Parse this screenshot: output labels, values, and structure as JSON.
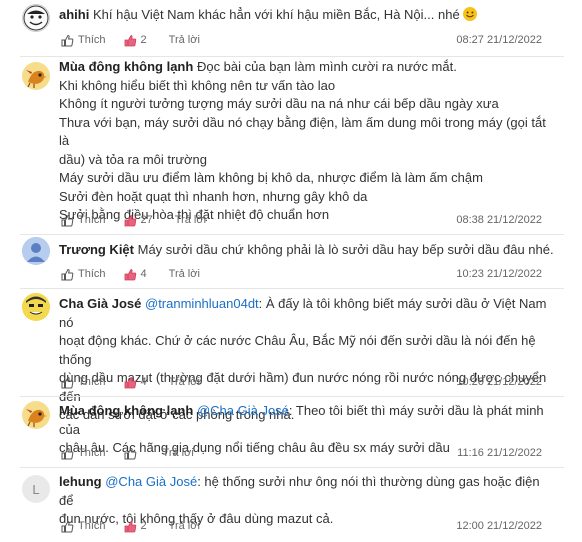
{
  "actions": {
    "like_label": "Thích",
    "reply_label": "Trả lời"
  },
  "colors": {
    "mention": "#1a6fc7",
    "vote_heart": "#d23c5a",
    "author": "#222222",
    "meta": "#666666"
  },
  "comments": [
    {
      "author": "ahihi",
      "avatar_icon": "meme-face-avatar",
      "mention": "",
      "lines": [
        "Khí hậu Việt Nam khác hẳn với khí hậu miền Bắc, Hà Nội... nhé"
      ],
      "has_emoji": true,
      "votes": "2",
      "time": "08:27 21/12/2022"
    },
    {
      "author": "Mùa đông không lạnh",
      "avatar_icon": "bird-avatar",
      "mention": "",
      "lines": [
        "Đọc bài của bạn làm mình cười ra nước mắt.",
        "Khi không hiểu biết thì không nên tư vấn tào lao",
        "Không ít người tưởng tượng máy sưởi dầu na ná như cái bếp dầu ngày xưa",
        "Thưa với bạn, máy sưởi dầu nó chạy bằng điện, làm ấm dung môi trong máy (gọi tắt là",
        "dầu) và tỏa ra môi trường",
        "Máy sưởi dầu ưu điểm làm không bị khô da, nhược điểm là làm ấm chậm",
        "Sưởi đèn hoặt quạt thì nhanh hơn, nhưng gây khô da",
        "Sưởi bằng điều hòa thì đặt nhiệt độ chuẩn hơn"
      ],
      "votes": "27",
      "time": "08:38 21/12/2022"
    },
    {
      "author": "Trương Kiệt",
      "avatar_icon": "default-user-avatar",
      "mention": "",
      "lines": [
        "Máy sưởi dầu chứ không phải là lò sưởi dầu hay bếp sưởi dầu đâu nhé."
      ],
      "votes": "4",
      "time": "10:23 21/12/2022"
    },
    {
      "author": "Cha Già José",
      "avatar_icon": "cartoon-face-avatar",
      "mention": "@tranminhluan04dt",
      "lines": [
        ": À đấy là tôi không biết máy sưởi dầu ở Việt Nam nó",
        "hoạt động khác. Chứ ở các nước Châu Âu, Bắc Mỹ nói đến sưởi dầu là nói đến hệ thống",
        "dùng dầu mazut (thường đặt dưới hầm) đun nước nóng rồi nước nóng được chuyển đến",
        "các dàn sưởi đặt ở các phòng trong nhà."
      ],
      "votes": "4",
      "time": "10:26 21/12/2022"
    },
    {
      "author": "Mùa đông không lạnh",
      "avatar_icon": "bird-avatar",
      "mention": "@Cha Già José",
      "lines": [
        ": Theo tôi biết thì máy sưởi dầu là phát minh của",
        "châu âu. Các hãng gia dụng nổi tiếng châu âu đều sx máy sưởi dầu"
      ],
      "votes": "",
      "time": "11:16 21/12/2022"
    },
    {
      "author": "lehung",
      "avatar_icon": "letter-l-avatar",
      "avatar_letter": "L",
      "mention": "@Cha Già José",
      "lines": [
        ": hệ thống sưởi như ông nói thì thường dùng gas hoặc điện để",
        "đun nước, tôi không thấy ở đâu dùng mazut cả."
      ],
      "votes": "2",
      "time": "12:00 21/12/2022"
    }
  ]
}
